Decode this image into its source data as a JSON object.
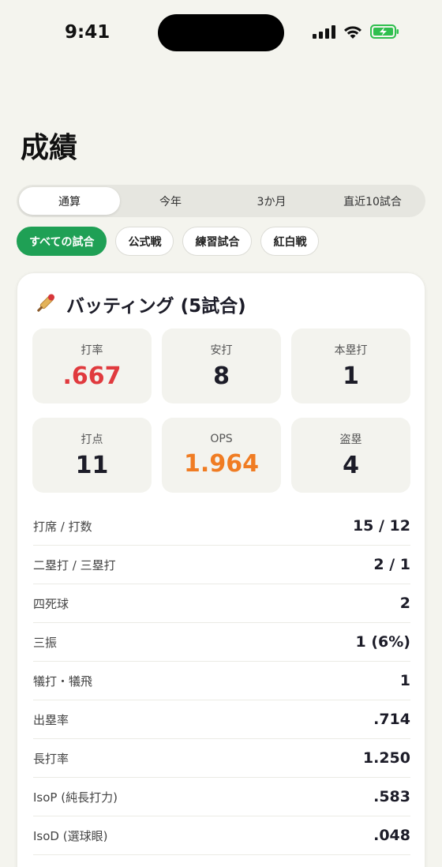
{
  "status": {
    "time": "9:41"
  },
  "page_title": "成績",
  "segments": [
    {
      "label": "通算",
      "active": true
    },
    {
      "label": "今年",
      "active": false
    },
    {
      "label": "3か月",
      "active": false
    },
    {
      "label": "直近10試合",
      "active": false
    }
  ],
  "chips": [
    {
      "label": "すべての試合",
      "active": true
    },
    {
      "label": "公式戦",
      "active": false
    },
    {
      "label": "練習試合",
      "active": false
    },
    {
      "label": "紅白戦",
      "active": false
    }
  ],
  "batting": {
    "title": "バッティング (5試合)",
    "stats": [
      {
        "label": "打率",
        "value": ".667",
        "accent": "#e03a3e"
      },
      {
        "label": "安打",
        "value": "8"
      },
      {
        "label": "本塁打",
        "value": "1"
      },
      {
        "label": "打点",
        "value": "11"
      },
      {
        "label": "OPS",
        "value": "1.964",
        "accent": "#f07c23"
      },
      {
        "label": "盗塁",
        "value": "4"
      }
    ],
    "rows": [
      {
        "label": "打席 / 打数",
        "value": "15 / 12"
      },
      {
        "label": "二塁打 / 三塁打",
        "value": "2 / 1"
      },
      {
        "label": "四死球",
        "value": "2"
      },
      {
        "label": "三振",
        "value": "1 (6%)"
      },
      {
        "label": "犠打・犠飛",
        "value": "1"
      },
      {
        "label": "出塁率",
        "value": ".714"
      },
      {
        "label": "長打率",
        "value": "1.250"
      },
      {
        "label": "IsoP (純長打力)",
        "value": ".583"
      },
      {
        "label": "IsoD (選球眼)",
        "value": ".048"
      }
    ]
  },
  "colors": {
    "accent_green": "#1fa055",
    "background": "#f4f4ee"
  },
  "icons": {
    "batting": "cricket-bat-icon"
  }
}
